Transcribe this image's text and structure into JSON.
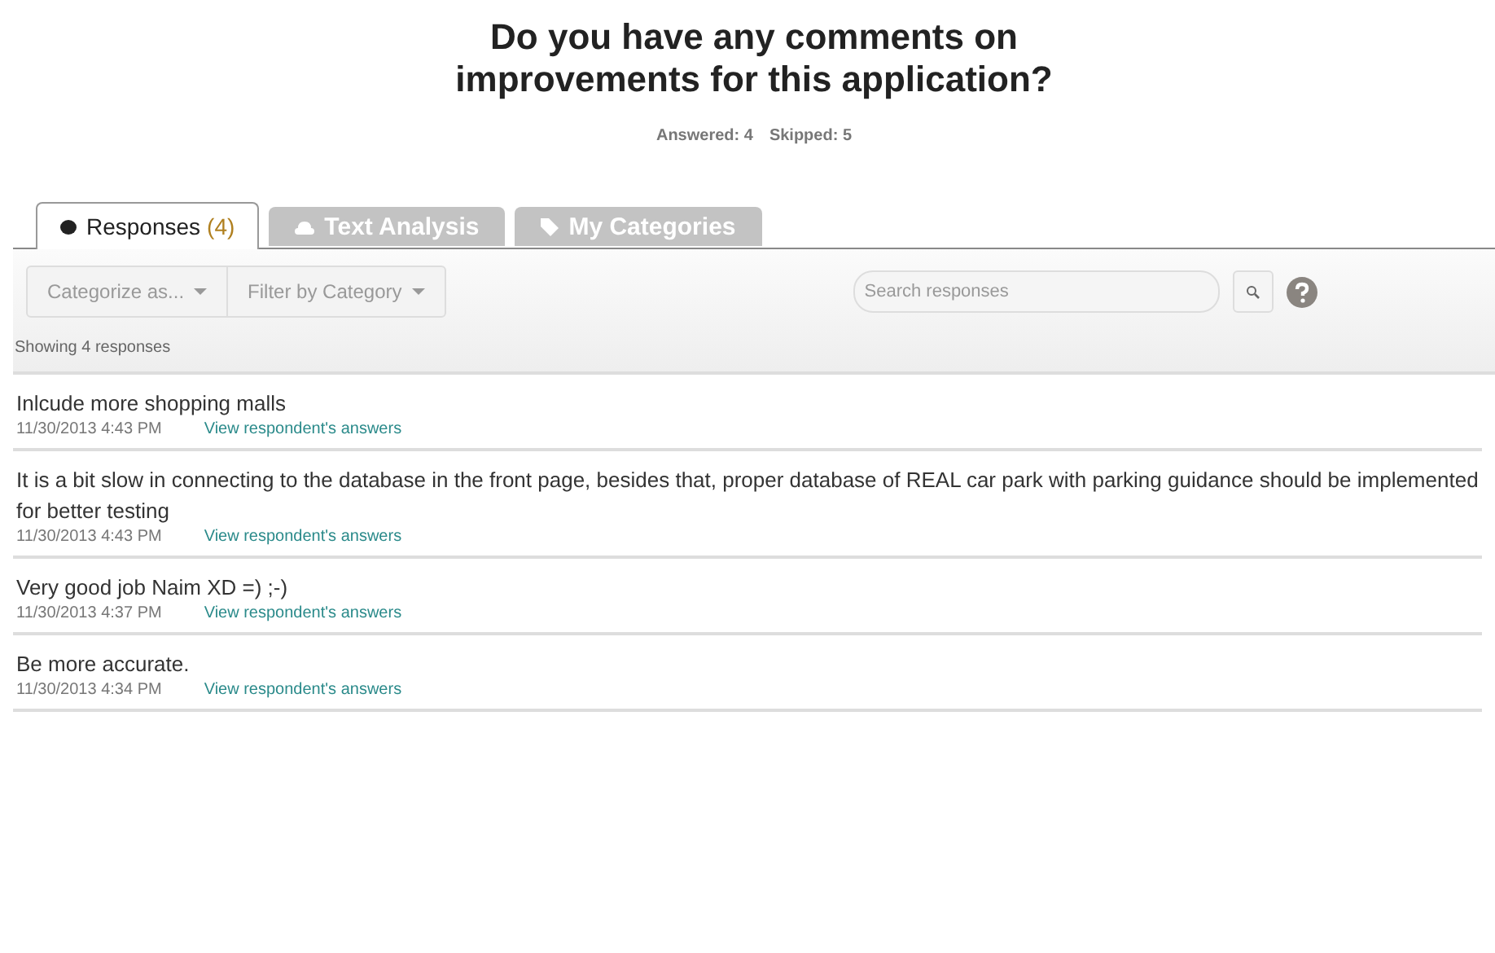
{
  "title": "Do you have any comments on improvements for this application?",
  "stats": [
    {
      "label": "Answered:",
      "value": "4"
    },
    {
      "label": "Skipped:",
      "value": "5"
    }
  ],
  "tabs": [
    {
      "label": "Responses",
      "count": "(4)",
      "selected": true
    },
    {
      "label": "Text Analysis",
      "selected": false
    },
    {
      "label": "My Categories",
      "selected": false
    }
  ],
  "toolbar": {
    "dropdowns": [
      "Categorize as...",
      "Filter by Category"
    ],
    "search": {
      "placeholder": "Search responses"
    }
  },
  "showing": "Showing 4 responses",
  "responses": [
    {
      "text": "Inlcude more shopping malls",
      "time": "11/30/2013 4:43 PM",
      "link": "View respondent's answers"
    },
    {
      "text": "It is a bit slow in connecting to the database in the front page, besides that, proper database of REAL car park with parking guidance should be implemented for better testing",
      "time": "11/30/2013 4:43 PM",
      "link": "View respondent's answers"
    },
    {
      "text": "Very good job Naim XD =) ;-)",
      "time": "11/30/2013 4:37 PM",
      "link": "View respondent's answers"
    },
    {
      "text": "Be more accurate.",
      "time": "11/30/2013 4:34 PM",
      "link": "View respondent's answers"
    }
  ]
}
